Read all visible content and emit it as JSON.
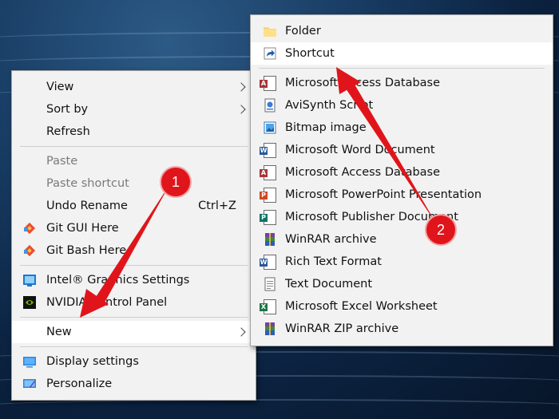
{
  "desktop_menu": {
    "items": [
      {
        "label": "View"
      },
      {
        "label": "Sort by"
      },
      {
        "label": "Refresh"
      },
      {
        "label": "Paste"
      },
      {
        "label": "Paste shortcut"
      },
      {
        "label": "Undo Rename",
        "shortcut": "Ctrl+Z"
      },
      {
        "label": "Git GUI Here"
      },
      {
        "label": "Git Bash Here"
      },
      {
        "label": "Intel® Graphics Settings"
      },
      {
        "label": "NVIDIA Control Panel"
      },
      {
        "label": "New"
      },
      {
        "label": "Display settings"
      },
      {
        "label": "Personalize"
      }
    ]
  },
  "new_submenu": {
    "items": [
      {
        "label": "Folder"
      },
      {
        "label": "Shortcut"
      },
      {
        "label": "Microsoft Access Database"
      },
      {
        "label": "AviSynth Script"
      },
      {
        "label": "Bitmap image"
      },
      {
        "label": "Microsoft Word Document"
      },
      {
        "label": "Microsoft Access Database"
      },
      {
        "label": "Microsoft PowerPoint Presentation"
      },
      {
        "label": "Microsoft Publisher Document"
      },
      {
        "label": "WinRAR archive"
      },
      {
        "label": "Rich Text Format"
      },
      {
        "label": "Text Document"
      },
      {
        "label": "Microsoft Excel Worksheet"
      },
      {
        "label": "WinRAR ZIP archive"
      }
    ]
  },
  "annotations": {
    "step1": "1",
    "step2": "2"
  },
  "colors": {
    "annotation_red": "#e0151b",
    "menu_bg": "#f2f2f2",
    "highlight": "#ffffff"
  }
}
